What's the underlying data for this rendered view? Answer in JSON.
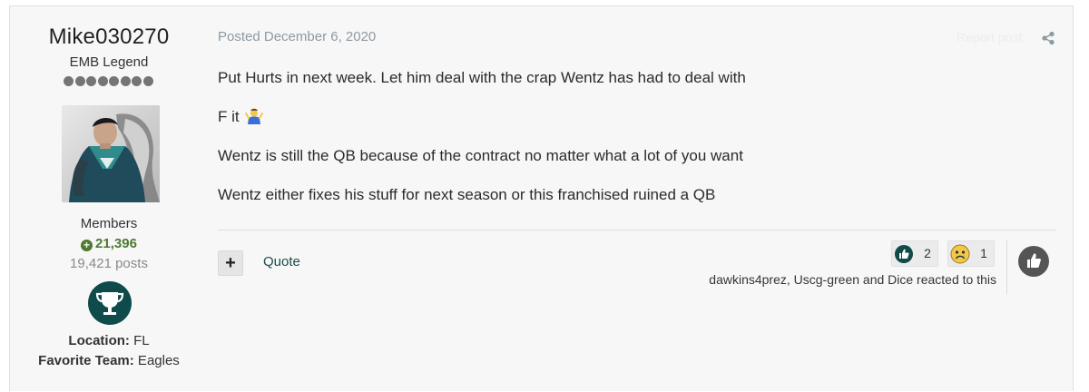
{
  "author": {
    "username": "Mike030270",
    "title": "EMB Legend",
    "pip_count": 8,
    "group": "Members",
    "reputation": "21,396",
    "posts": "19,421 posts",
    "location_label": "Location:",
    "location_value": " FL",
    "team_label": "Favorite Team:",
    "team_value": " Eagles",
    "avatar_icon": "superhero-avatar",
    "badge_icon": "trophy-icon"
  },
  "post": {
    "meta": "Posted December 6, 2020",
    "report_label": "Report post",
    "paragraphs": [
      "Put Hurts in next week. Let him deal with the crap Wentz has had to deal with",
      "F it",
      "Wentz is still the QB because of the contract no matter what a lot of you want",
      "Wentz either fixes his stuff for next season or this franchised ruined a QB"
    ],
    "emoji_icon": "person-shrugging-emoji"
  },
  "footer": {
    "multiquote_label": "+",
    "quote_label": "Quote",
    "reactions": [
      {
        "icon": "thumbs-up-icon",
        "count": "2"
      },
      {
        "icon": "sad-face-icon",
        "count": "1"
      }
    ],
    "reacted_text": "dawkins4prez, Uscg-green and Dice reacted to this"
  },
  "colors": {
    "reputation": "#4c7a2f",
    "accent": "#1a4d4d",
    "meta": "#8d9aa2"
  }
}
